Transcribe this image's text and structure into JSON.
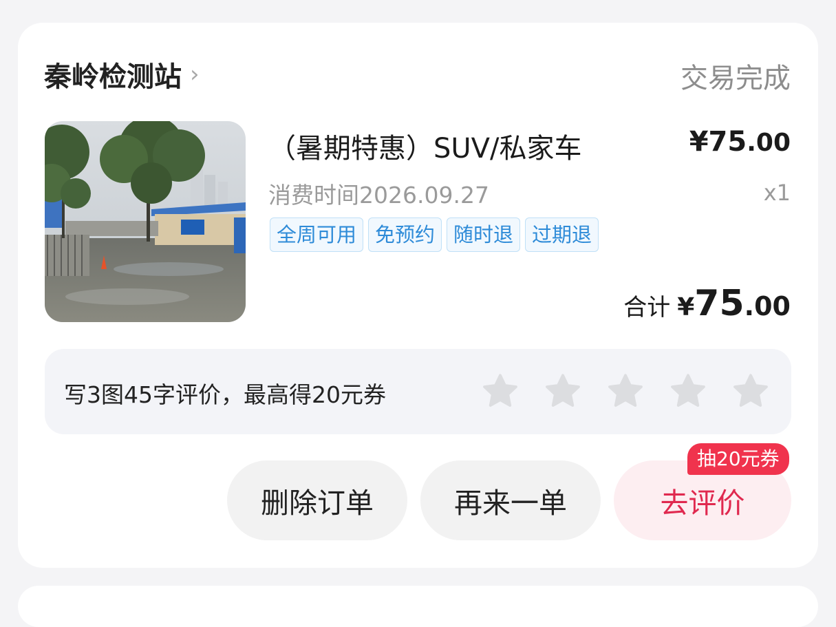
{
  "order": {
    "shop_name": "秦岭检测站",
    "status": "交易完成",
    "item": {
      "title": "（暑期特惠）SUV/私家车",
      "price_currency": "¥",
      "price_int": "75",
      "price_dec": ".00",
      "quantity": "x1",
      "consume_time": "消费时间2026.09.27",
      "tags": [
        "全周可用",
        "免预约",
        "随时退",
        "过期退"
      ]
    },
    "total": {
      "label": "合计",
      "currency": "¥",
      "int": "75",
      "dec": ".00"
    }
  },
  "review_prompt": {
    "text": "写3图45字评价，最高得20元券",
    "stars": 5,
    "rating": 0
  },
  "actions": {
    "delete_label": "删除订单",
    "reorder_label": "再来一单",
    "review_label": "去评价",
    "coupon_badge": "抽20元券"
  },
  "colors": {
    "accent": "#e0294f",
    "tag_blue": "#2e8bd8",
    "badge_red": "#f0334d"
  }
}
